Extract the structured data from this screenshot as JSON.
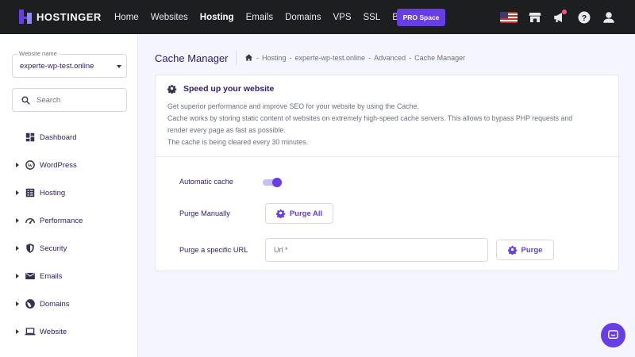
{
  "brand": {
    "name": "HOSTINGER"
  },
  "nav": [
    {
      "label": "Home",
      "active": false
    },
    {
      "label": "Websites",
      "active": false
    },
    {
      "label": "Hosting",
      "active": true
    },
    {
      "label": "Emails",
      "active": false
    },
    {
      "label": "Domains",
      "active": false
    },
    {
      "label": "VPS",
      "active": false
    },
    {
      "label": "SSL",
      "active": false
    },
    {
      "label": "Billing",
      "active": false
    }
  ],
  "pro_button": "PRO Space",
  "top_icons": [
    "us-flag-icon",
    "store-icon",
    "announcement-icon",
    "help-icon",
    "account-icon"
  ],
  "sidebar": {
    "website_select": {
      "label": "Website name",
      "value": "experte-wp-test.online"
    },
    "search": {
      "placeholder": "Search"
    },
    "items": [
      {
        "label": "Dashboard",
        "icon": "dashboard-icon",
        "expandable": false
      },
      {
        "label": "WordPress",
        "icon": "wordpress-icon",
        "expandable": true
      },
      {
        "label": "Hosting",
        "icon": "hosting-icon",
        "expandable": true
      },
      {
        "label": "Performance",
        "icon": "performance-icon",
        "expandable": true
      },
      {
        "label": "Security",
        "icon": "shield-icon",
        "expandable": true
      },
      {
        "label": "Emails",
        "icon": "mail-icon",
        "expandable": true
      },
      {
        "label": "Domains",
        "icon": "globe-icon",
        "expandable": true
      },
      {
        "label": "Website",
        "icon": "laptop-icon",
        "expandable": true
      }
    ]
  },
  "page": {
    "title": "Cache Manager",
    "breadcrumb": [
      "Hosting",
      "experte-wp-test.online",
      "Advanced",
      "Cache Manager"
    ],
    "breadcrumb_separator": "-"
  },
  "card": {
    "title": "Speed up your website",
    "description": [
      "Get superior performance and improve SEO for your website by using the Cache.",
      "Cache works by storing static content of websites on extremely high-speed cache servers. This allows to bypass PHP requests and",
      "render every page as fast as possible.",
      "The cache is being cleared every 30 minutes."
    ],
    "automatic_cache": {
      "label": "Automatic cache",
      "enabled": true
    },
    "purge_manually": {
      "label": "Purge Manually",
      "button": "Purge All"
    },
    "purge_url": {
      "label": "Purge a specific URL",
      "placeholder": "Url *",
      "button": "Purge"
    }
  },
  "colors": {
    "accent": "#673de6",
    "topbar": "#1d1e20",
    "text": "#2f1c6a",
    "muted": "#6d7081",
    "background": "#f4f5ff"
  }
}
